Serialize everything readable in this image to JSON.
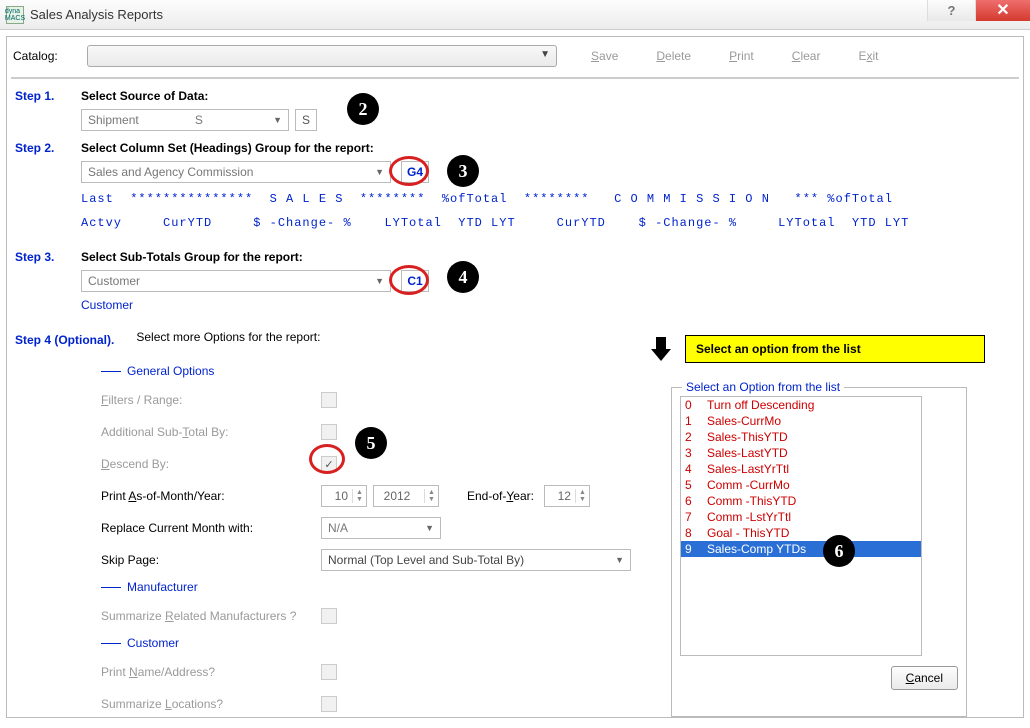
{
  "window": {
    "title": "Sales Analysis Reports",
    "app_icon_text": "dyna MACS"
  },
  "titlebar_buttons": {
    "help": "?",
    "close": "✕"
  },
  "catalog": {
    "label": "Catalog:",
    "value": ""
  },
  "actions": {
    "save": "Save",
    "delete": "Delete",
    "print": "Print",
    "clear": "Clear",
    "exit": "Exit"
  },
  "step1": {
    "label": "Step 1.",
    "title": "Select Source of Data:",
    "source_value": "Shipment",
    "source_code": "S",
    "code_btn": "S"
  },
  "step2": {
    "label": "Step 2.",
    "title": "Select Column Set (Headings) Group for the report:",
    "group_value": "Sales and Agency Commission",
    "group_code": "G4",
    "preview_line1": "Last  ***************  S A L E S  ********  %ofTotal  ********   C O M M I S S I O N   *** %ofTotal",
    "preview_line2": "Actvy     CurYTD     $ -Change- %    LYTotal  YTD LYT     CurYTD    $ -Change- %     LYTotal  YTD LYT"
  },
  "step3": {
    "label": "Step 3.",
    "title": "Select Sub-Totals Group for the report:",
    "subtotal_value": "Customer",
    "subtotal_code": "C1",
    "detail": "Customer"
  },
  "step4": {
    "label": "Step 4 (Optional).",
    "title": "Select more Options for the report:",
    "section_general": "General Options",
    "filters_label": "Filters / Range:",
    "addl_subtotal_label": "Additional Sub-Total By:",
    "descend_label": "Descend By:",
    "descend_checked": true,
    "print_asof_label": "Print As-of-Month/Year:",
    "asof_month": "10",
    "asof_year": "2012",
    "eoy_label": "End-of-Year:",
    "eoy_value": "12",
    "replace_label": "Replace Current Month with:",
    "replace_value": "N/A",
    "skip_label": "Skip Page:",
    "skip_value": "Normal (Top Level and Sub-Total By)",
    "section_manufacturer": "Manufacturer",
    "summarize_related_label": "Summarize Related Manufacturers ?",
    "section_customer": "Customer",
    "print_name_label": "Print Name/Address?",
    "summarize_loc_label": "Summarize Locations?"
  },
  "popup": {
    "tooltip": "Select an option from the list",
    "legend": "Select an Option from the list",
    "options": [
      {
        "idx": "0",
        "label": "Turn off Descending"
      },
      {
        "idx": "1",
        "label": "Sales-CurrMo"
      },
      {
        "idx": "2",
        "label": "Sales-ThisYTD"
      },
      {
        "idx": "3",
        "label": "Sales-LastYTD"
      },
      {
        "idx": "4",
        "label": "Sales-LastYrTtl"
      },
      {
        "idx": "5",
        "label": "Comm -CurrMo"
      },
      {
        "idx": "6",
        "label": "Comm -ThisYTD"
      },
      {
        "idx": "7",
        "label": "Comm -LstYrTtl"
      },
      {
        "idx": "8",
        "label": "Goal - ThisYTD"
      },
      {
        "idx": "9",
        "label": "Sales-Comp YTDs"
      }
    ],
    "selected_index": 9,
    "cancel": "Cancel"
  },
  "annotations": {
    "b2": "2",
    "b3": "3",
    "b4": "4",
    "b5": "5",
    "b6": "6"
  }
}
